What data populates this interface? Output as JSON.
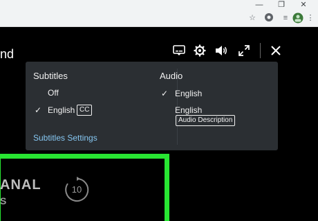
{
  "browser": {
    "icons": [
      "minimize-icon",
      "restore-icon",
      "close-icon",
      "star-icon",
      "extension-icon",
      "menu-icon",
      "profile-avatar",
      "more-icon"
    ]
  },
  "player": {
    "title_partial": "nd",
    "controls": [
      "subtitles-icon",
      "settings-icon",
      "volume-icon",
      "fullscreen-icon",
      "close-icon"
    ]
  },
  "subtitles": {
    "heading": "Subtitles",
    "options": [
      {
        "label": "Off",
        "selected": false
      },
      {
        "label": "English",
        "badge": "CC",
        "selected": true
      }
    ],
    "settings_link": "Subtitles Settings"
  },
  "audio": {
    "heading": "Audio",
    "options": [
      {
        "label": "English",
        "selected": true
      },
      {
        "label": "English",
        "badge": "Audio Description",
        "selected": false
      }
    ]
  },
  "thumbnail": {
    "text_line1": "ANAL",
    "text_line2": "S",
    "replay_seconds": "10"
  },
  "colors": {
    "highlight": "#28e632",
    "popup_bg": "#2b2f33",
    "link": "#86c7f2"
  }
}
